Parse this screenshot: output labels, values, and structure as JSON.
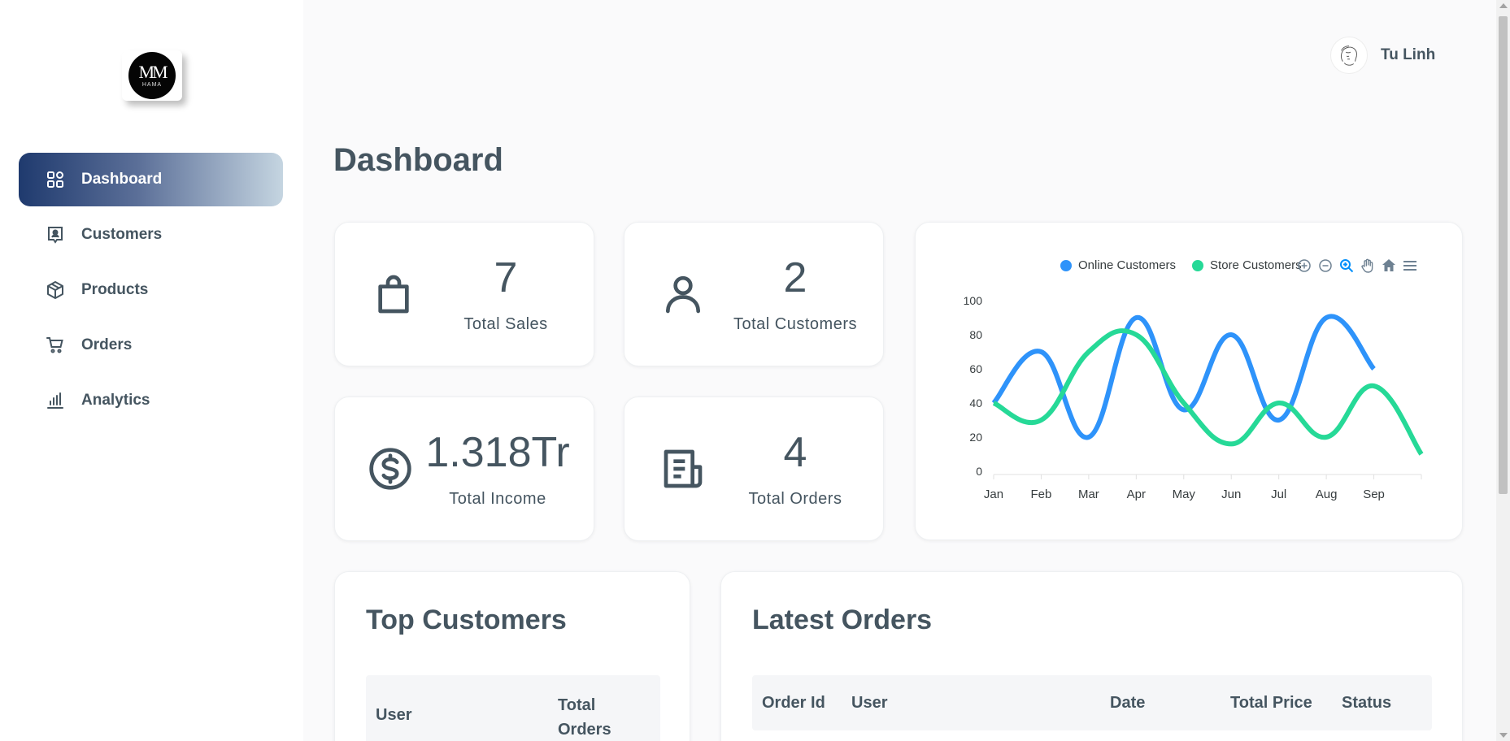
{
  "logo": {
    "monogram": "MM",
    "text": "HAMA"
  },
  "sidebar": {
    "items": [
      {
        "label": "Dashboard",
        "icon": "grid-icon",
        "active": true
      },
      {
        "label": "Customers",
        "icon": "contact-icon",
        "active": false
      },
      {
        "label": "Products",
        "icon": "cube-icon",
        "active": false
      },
      {
        "label": "Orders",
        "icon": "cart-icon",
        "active": false
      },
      {
        "label": "Analytics",
        "icon": "bar-chart-icon",
        "active": false
      }
    ]
  },
  "user": {
    "name": "Tu Linh",
    "avatar_icon": "sketch-avatar-icon"
  },
  "page": {
    "title": "Dashboard"
  },
  "stats": [
    {
      "value": "7",
      "label": "Total Sales",
      "icon": "shopping-bag-icon"
    },
    {
      "value": "2",
      "label": "Total Customers",
      "icon": "user-icon"
    },
    {
      "value": "1.318Tr",
      "label": "Total Income",
      "icon": "dollar-circle-icon"
    },
    {
      "value": "4",
      "label": "Total Orders",
      "icon": "receipt-icon"
    }
  ],
  "chart_data": {
    "type": "line",
    "categories": [
      "Jan",
      "Feb",
      "Mar",
      "Apr",
      "May",
      "Jun",
      "Jul",
      "Aug",
      "Sep",
      ""
    ],
    "series": [
      {
        "name": "Online Customers",
        "color": "#2e93fa",
        "values": [
          40,
          70,
          20,
          90,
          36,
          80,
          30,
          90,
          60,
          null
        ]
      },
      {
        "name": "Store Customers",
        "color": "#26d997",
        "values": [
          40,
          30,
          70,
          80,
          40,
          16,
          40,
          20,
          50,
          10
        ]
      }
    ],
    "ylim": [
      0,
      100
    ],
    "yticks": [
      0,
      20,
      40,
      60,
      80,
      100
    ],
    "legend": "top",
    "grid": false,
    "curve": "smooth"
  },
  "chart_toolbar": [
    "zoom-in-icon",
    "zoom-out-icon",
    "zoom-select-icon",
    "pan-hand-icon",
    "reset-home-icon",
    "menu-icon"
  ],
  "top_customers": {
    "title": "Top Customers",
    "columns": [
      "User",
      "Total Orders"
    ]
  },
  "latest_orders": {
    "title": "Latest Orders",
    "columns": [
      "Order Id",
      "User",
      "Date",
      "Total Price",
      "Status"
    ]
  },
  "colors": {
    "active_gradient_start": "#1f3a6e",
    "active_gradient_end": "#c5d5e1",
    "text": "#455560",
    "background": "#fafafb"
  }
}
